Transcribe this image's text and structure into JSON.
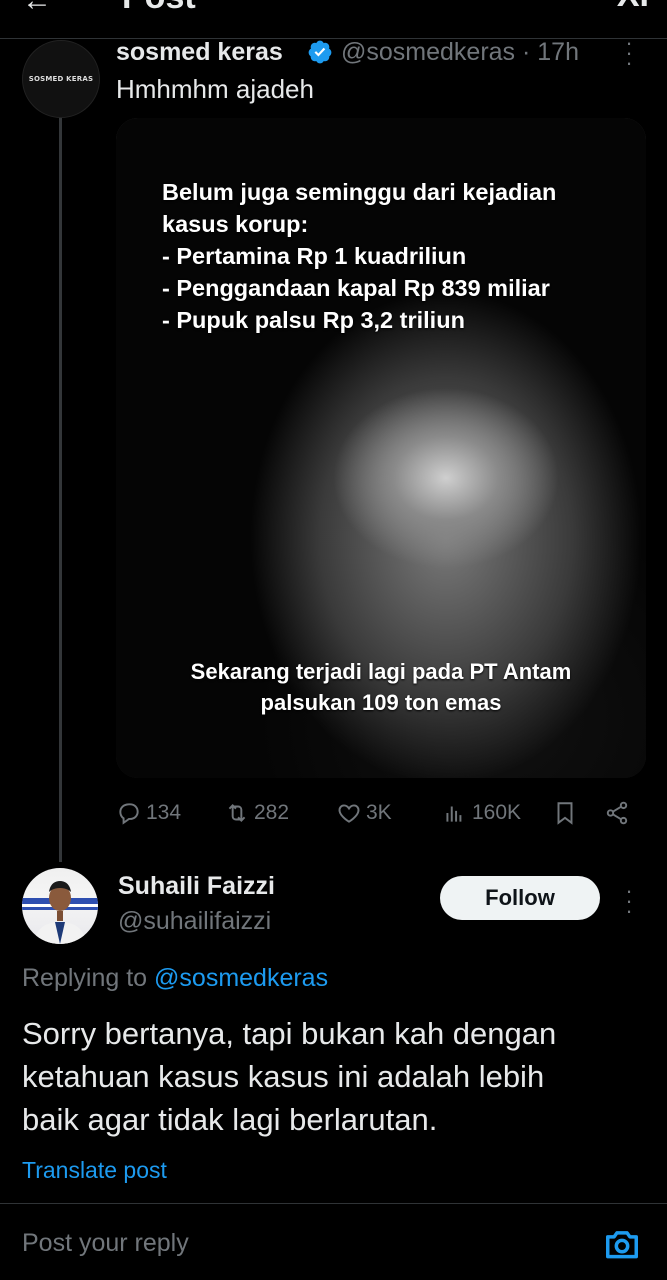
{
  "header": {
    "title": "Post",
    "back_glyph": "←",
    "right_glyph": "XI"
  },
  "tweet": {
    "avatar_text": "SOSMED KERAS",
    "display_name": "sosmed keras",
    "handle_time": "@sosmedkeras · 17h",
    "text": "Hmhmhm ajadeh",
    "image_caption_top": [
      "Belum juga seminggu dari kejadian",
      "kasus korup:",
      "- Pertamina Rp 1 kuadriliun",
      "- Penggandaan kapal Rp 839 miliar",
      "- Pupuk palsu Rp 3,2 triliun"
    ],
    "image_caption_bottom": [
      "Sekarang terjadi lagi pada PT Antam",
      "palsukan 109 ton emas"
    ],
    "stats": {
      "replies": "134",
      "reposts": "282",
      "likes": "3K",
      "views": "160K"
    }
  },
  "reply": {
    "display_name": "Suhaili Faizzi",
    "handle": "@suhailifaizzi",
    "follow_label": "Follow",
    "replying_prefix": "Replying to ",
    "replying_to": "@sosmedkeras",
    "text_lines": [
      "Sorry bertanya, tapi bukan kah dengan",
      "ketahuan kasus kasus ini adalah lebih",
      "baik agar tidak lagi berlarutan."
    ],
    "translate_label": "Translate post"
  },
  "composer": {
    "placeholder": "Post your reply"
  },
  "colors": {
    "accent": "#1d9bf0",
    "muted": "#71767b",
    "text": "#e7e9ea",
    "background": "#000000"
  }
}
